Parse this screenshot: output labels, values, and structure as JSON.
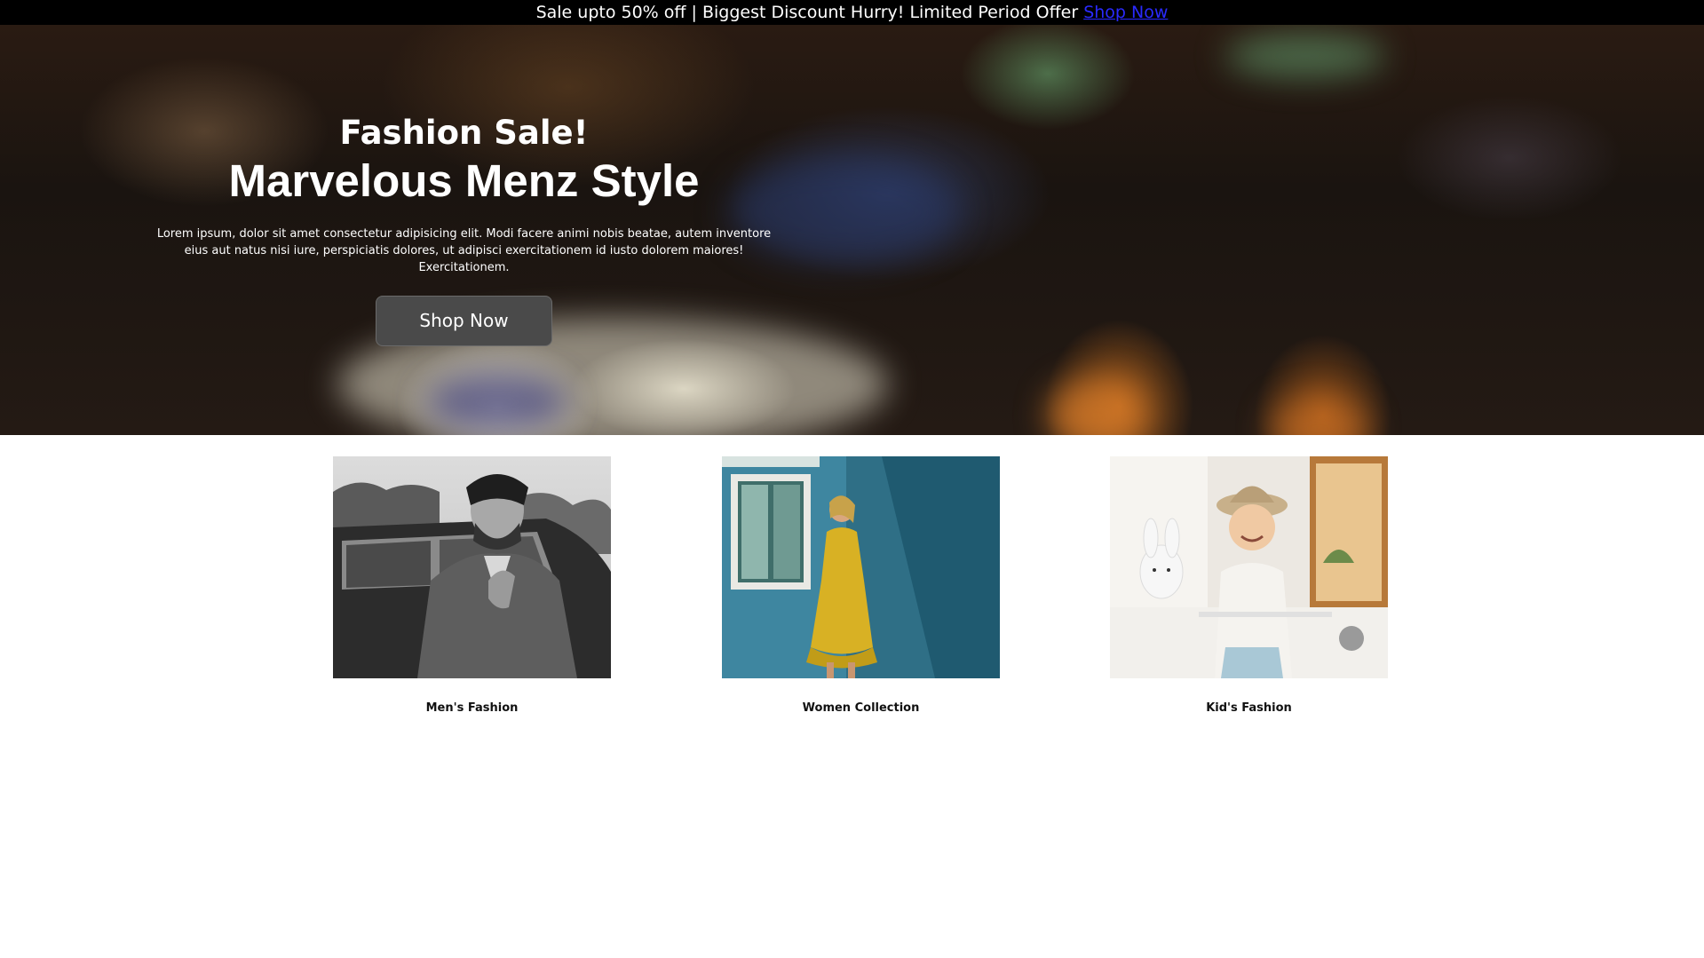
{
  "promo": {
    "text": "Sale upto 50% off | Biggest Discount Hurry! Limited Period Offer",
    "link_label": "Shop Now",
    "link_color": "#2a2aff"
  },
  "hero": {
    "title_small": "Fashion Sale!",
    "title_large": "Marvelous Menz Style",
    "description": "Lorem ipsum, dolor sit amet consectetur adipisicing elit. Modi facere animi nobis beatae, autem inventore eius aut natus nisi iure, perspiciatis dolores, ut adipisci exercitationem id iusto dolorem maiores! Exercitationem.",
    "button_label": "Shop Now"
  },
  "collections": [
    {
      "label": "Men's Fashion",
      "image": "man-in-suit-photo"
    },
    {
      "label": "Women Collection",
      "image": "woman-yellow-dress-photo"
    },
    {
      "label": "Kid's Fashion",
      "image": "boy-with-hat-photo"
    }
  ]
}
